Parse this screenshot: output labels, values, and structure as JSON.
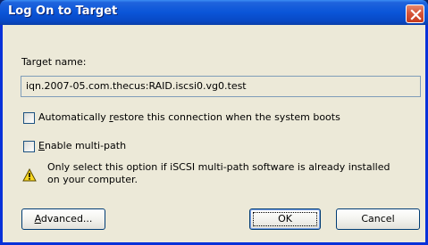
{
  "window": {
    "title": "Log On to Target"
  },
  "target": {
    "label": "Target name:",
    "value": "iqn.2007-05.com.thecus:RAID.iscsi0.vg0.test"
  },
  "options": {
    "auto_restore": {
      "checked": false,
      "label_pre": "Automatically ",
      "label_accel": "r",
      "label_post": "estore this connection when the system boots"
    },
    "multipath": {
      "checked": false,
      "label_accel": "E",
      "label_post": "nable multi-path"
    }
  },
  "warning": {
    "icon": "warning-icon",
    "line1": "Only select this option if iSCSI multi-path software is already installed",
    "line2": "on your computer."
  },
  "buttons": {
    "advanced_accel": "A",
    "advanced_post": "dvanced...",
    "ok": "OK",
    "cancel": "Cancel"
  },
  "colors": {
    "title_bar": "#0a55d8",
    "dialog_bg": "#ece9d8",
    "close_button": "#d6553a",
    "warning_yellow": "#f9d71c"
  }
}
